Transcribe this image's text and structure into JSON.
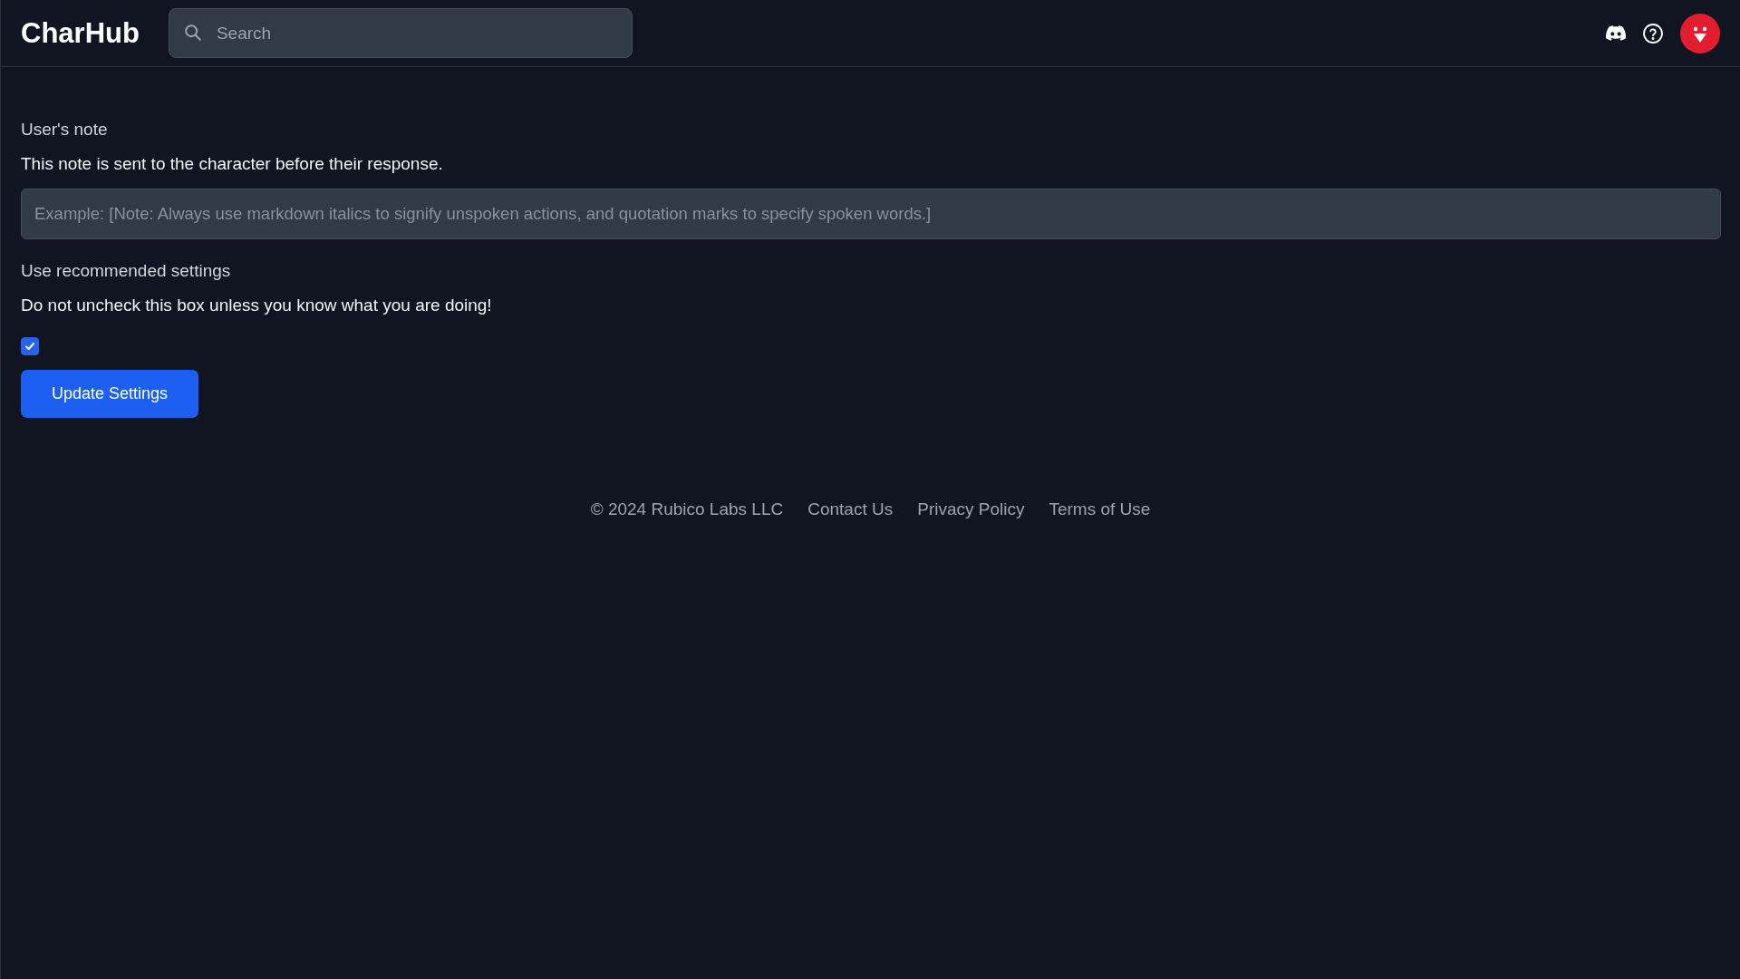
{
  "header": {
    "logo": "CharHub",
    "search": {
      "placeholder": "Search"
    }
  },
  "form": {
    "note_label": "User's note",
    "note_help": "This note is sent to the character before their response.",
    "note_field": {
      "placeholder": "Example: [Note: Always use markdown italics to signify unspoken actions, and quotation marks to specify spoken words.]"
    },
    "recommended_label": "Use recommended settings",
    "recommended_help": "Do not uncheck this box unless you know what you are doing!",
    "recommended": {
      "checked": true
    },
    "submit": "Update Settings"
  },
  "footer": {
    "copyright": "© 2024 Rubico Labs LLC",
    "links": [
      "Contact Us",
      "Privacy Policy",
      "Terms of Use"
    ]
  }
}
